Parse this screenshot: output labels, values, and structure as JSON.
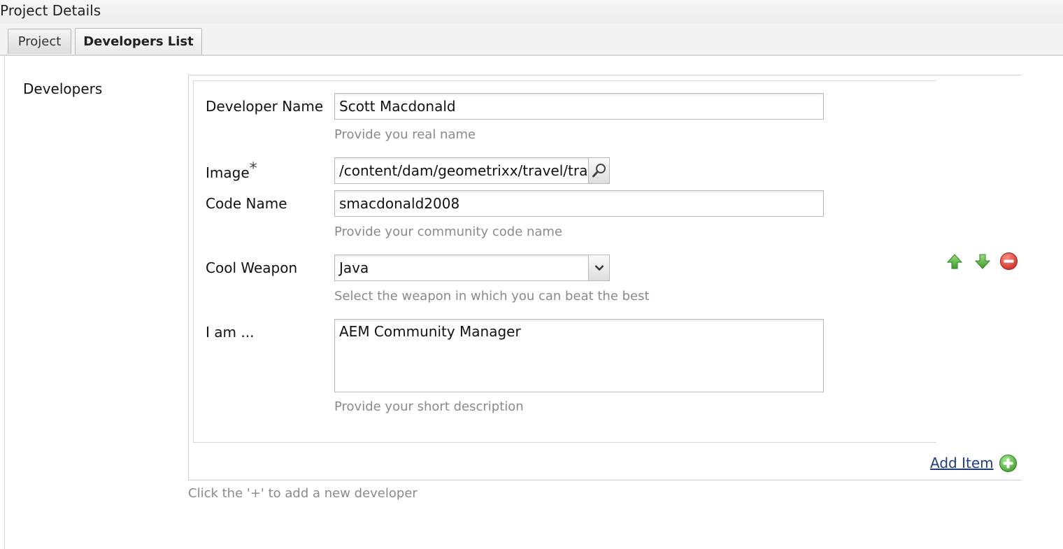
{
  "window": {
    "title": "Project Details"
  },
  "tabs": [
    {
      "label": "Project"
    },
    {
      "label": "Developers List"
    }
  ],
  "section": {
    "label": "Developers"
  },
  "form": {
    "developer_name": {
      "label": "Developer Name",
      "value": "Scott Macdonald",
      "hint": "Provide you real name"
    },
    "image": {
      "label": "Image",
      "required_mark": "*",
      "value": "/content/dam/geometrixx/travel/train_"
    },
    "code_name": {
      "label": "Code Name",
      "value": "smacdonald2008",
      "hint": "Provide your community code name"
    },
    "cool_weapon": {
      "label": "Cool Weapon",
      "value": "Java",
      "hint": "Select the weapon in which you can beat the best"
    },
    "i_am": {
      "label": "I am ...",
      "value": "AEM Community Manager",
      "hint": "Provide your short description"
    }
  },
  "actions": {
    "add_item": "Add Item",
    "footer_hint": "Click the '+' to add a new developer"
  },
  "icons": {
    "move_up": "arrow-up-icon",
    "move_down": "arrow-down-icon",
    "remove": "remove-icon",
    "add": "add-icon",
    "search": "search-icon",
    "dropdown": "chevron-down-icon"
  },
  "colors": {
    "green": "#4caf3e",
    "red": "#d9332b",
    "link": "#1f3f7a",
    "hint": "#8a8a8a"
  }
}
